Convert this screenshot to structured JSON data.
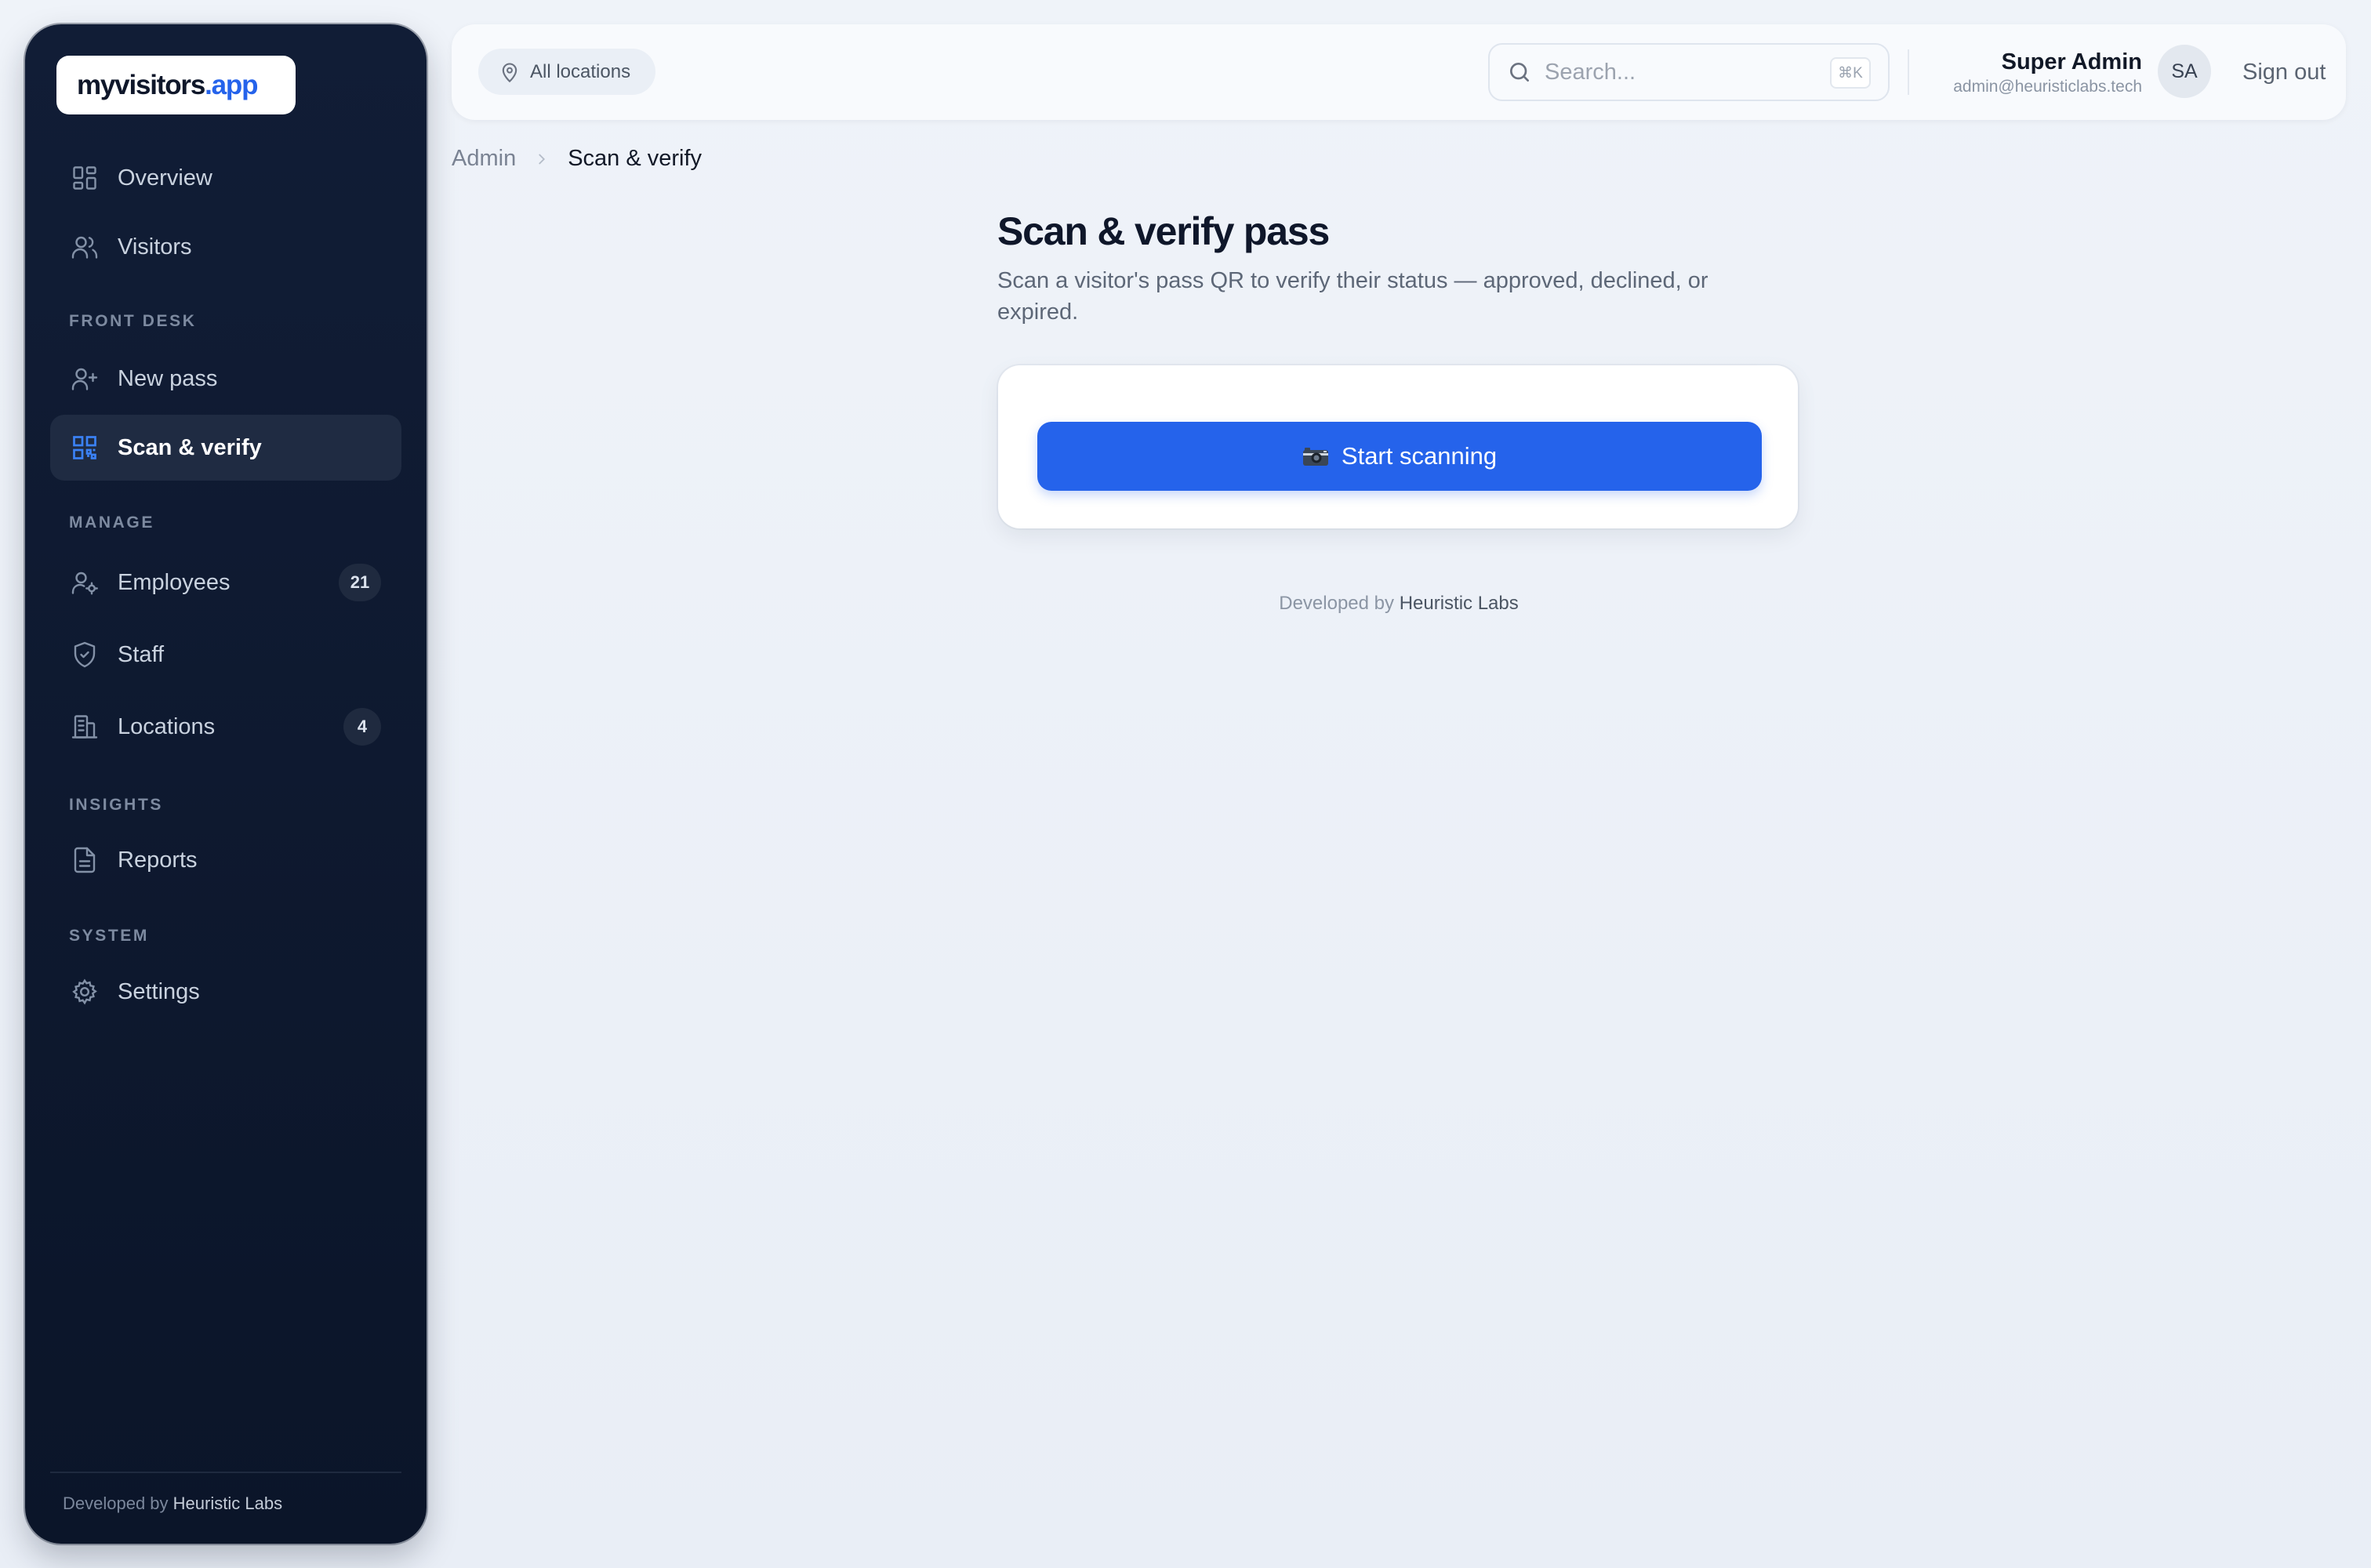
{
  "brand": {
    "logo_part1": "myvisitors",
    "logo_part2": ".app"
  },
  "sidebar": {
    "nav_top": [
      {
        "label": "Overview"
      },
      {
        "label": "Visitors"
      }
    ],
    "sections": {
      "front_desk": "FRONT DESK",
      "manage": "MANAGE",
      "insights": "INSIGHTS",
      "system": "SYSTEM"
    },
    "front_desk_items": [
      {
        "label": "New pass"
      },
      {
        "label": "Scan & verify",
        "active": true
      }
    ],
    "manage_items": [
      {
        "label": "Employees",
        "badge": "21"
      },
      {
        "label": "Staff"
      },
      {
        "label": "Locations",
        "badge": "4"
      }
    ],
    "insights_items": [
      {
        "label": "Reports"
      }
    ],
    "system_items": [
      {
        "label": "Settings"
      }
    ],
    "footer": {
      "prefix": "Developed by",
      "brand": "Heuristic Labs"
    }
  },
  "topbar": {
    "location_filter": "All locations",
    "search": {
      "placeholder": "Search...",
      "shortcut": "⌘K"
    },
    "user": {
      "name": "Super Admin",
      "email": "admin@heuristiclabs.tech",
      "initials": "SA"
    },
    "sign_out": "Sign out"
  },
  "breadcrumb": {
    "root": "Admin",
    "current": "Scan & verify"
  },
  "main": {
    "title": "Scan & verify pass",
    "description": "Scan a visitor's pass QR to verify their status — approved, declined, or expired.",
    "start_button": "Start scanning",
    "footer": {
      "prefix": "Developed by",
      "brand": "Heuristic Labs"
    }
  },
  "colors": {
    "accent": "#2563eb",
    "sidebar_bg": "#0b1529",
    "page_bg": "#eef2f8"
  },
  "icons": {
    "overview": "grid-icon",
    "visitors": "users-icon",
    "new_pass": "user-plus-icon",
    "scan": "qr-code-icon",
    "employees": "user-cog-icon",
    "staff": "shield-icon",
    "locations": "building-icon",
    "reports": "file-text-icon",
    "settings": "gear-icon",
    "location_chip": "map-pin-icon",
    "search": "search-icon",
    "camera": "camera-icon"
  }
}
